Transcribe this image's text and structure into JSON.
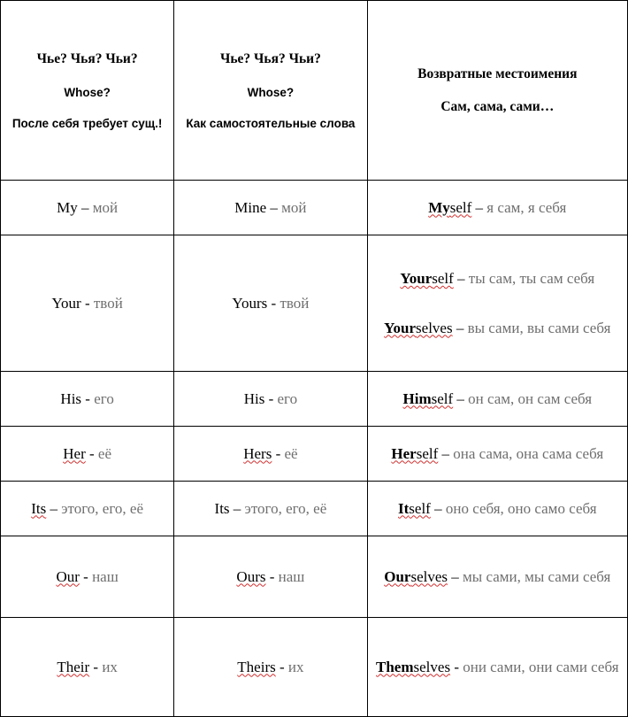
{
  "table": {
    "headers": [
      {
        "lines": [
          {
            "text": "Чье? Чья? Чьи?",
            "style": "serif"
          },
          {
            "text": "Whose?",
            "style": "sans"
          },
          {
            "text": "После себя требует сущ.!",
            "style": "sans"
          }
        ]
      },
      {
        "lines": [
          {
            "text": "Чье? Чья? Чьи?",
            "style": "serif"
          },
          {
            "text": "Whose?",
            "style": "sans"
          },
          {
            "text": "Как самостоятельные слова",
            "style": "sans"
          }
        ]
      },
      {
        "lines": [
          {
            "text": "Возвратные местоимения",
            "style": "serif"
          },
          {
            "text": "Сам, сама, сами…",
            "style": "serif"
          }
        ]
      }
    ],
    "rows": [
      {
        "col1": [
          {
            "eng": "My",
            "bold_part": "",
            "dash": "–",
            "rus": "мой",
            "spell": false
          }
        ],
        "col2": [
          {
            "eng": "Mine",
            "bold_part": "",
            "dash": "–",
            "rus": "мой",
            "spell": false
          }
        ],
        "col3": [
          {
            "eng": "Myself",
            "bold_part": "My",
            "dash": "–",
            "rus": "я сам, я себя",
            "spell": true
          }
        ]
      },
      {
        "col1": [
          {
            "eng": "Your",
            "bold_part": "",
            "dash": "-",
            "rus": "твой",
            "spell": false
          }
        ],
        "col2": [
          {
            "eng": "Yours",
            "bold_part": "",
            "dash": "-",
            "rus": "твой",
            "spell": false
          }
        ],
        "col3": [
          {
            "eng": "Yourself",
            "bold_part": "Your",
            "dash": "–",
            "rus": "ты сам, ты сам себя",
            "spell": true
          },
          {
            "eng": "Yourselves",
            "bold_part": "Your",
            "dash": "–",
            "rus": "вы сами, вы сами себя",
            "spell": true
          }
        ]
      },
      {
        "col1": [
          {
            "eng": "His",
            "bold_part": "",
            "dash": "-",
            "rus": "его",
            "spell": false
          }
        ],
        "col2": [
          {
            "eng": "His",
            "bold_part": "",
            "dash": "-",
            "rus": "его",
            "spell": false
          }
        ],
        "col3": [
          {
            "eng": "Himself",
            "bold_part": "Him",
            "dash": "–",
            "rus": "он сам, он сам себя",
            "spell": true
          }
        ]
      },
      {
        "col1": [
          {
            "eng": "Her",
            "bold_part": "",
            "dash": "-",
            "rus": "её",
            "spell": true
          }
        ],
        "col2": [
          {
            "eng": "Hers",
            "bold_part": "",
            "dash": "-",
            "rus": "её",
            "spell": true
          }
        ],
        "col3": [
          {
            "eng": "Herself",
            "bold_part": "Her",
            "dash": "–",
            "rus": "она сама, она сама себя",
            "spell": true
          }
        ]
      },
      {
        "col1": [
          {
            "eng": "Its",
            "bold_part": "",
            "dash": "–",
            "rus": "этого, его, её",
            "spell": true
          }
        ],
        "col2": [
          {
            "eng": "Its",
            "bold_part": "",
            "dash": "–",
            "rus": "этого, его, её",
            "spell": false
          }
        ],
        "col3": [
          {
            "eng": "Itself",
            "bold_part": "It",
            "dash": "–",
            "rus": "оно себя, оно само себя",
            "spell": true
          }
        ]
      },
      {
        "col1": [
          {
            "eng": "Our",
            "bold_part": "",
            "dash": "-",
            "rus": "наш",
            "spell": true
          }
        ],
        "col2": [
          {
            "eng": "Ours",
            "bold_part": "",
            "dash": "-",
            "rus": "наш",
            "spell": true
          }
        ],
        "col3": [
          {
            "eng": "Ourselves",
            "bold_part": "Our",
            "dash": "–",
            "rus": "мы сами, мы сами себя",
            "spell": true
          }
        ]
      },
      {
        "col1": [
          {
            "eng": "Their",
            "bold_part": "",
            "dash": "-",
            "rus": "их",
            "spell": true
          }
        ],
        "col2": [
          {
            "eng": "Theirs",
            "bold_part": "",
            "dash": "-",
            "rus": "их",
            "spell": true
          }
        ],
        "col3": [
          {
            "eng": "Themselves",
            "bold_part": "Them",
            "dash": "-",
            "rus": "они сами, они сами себя",
            "spell": true
          }
        ]
      }
    ]
  }
}
